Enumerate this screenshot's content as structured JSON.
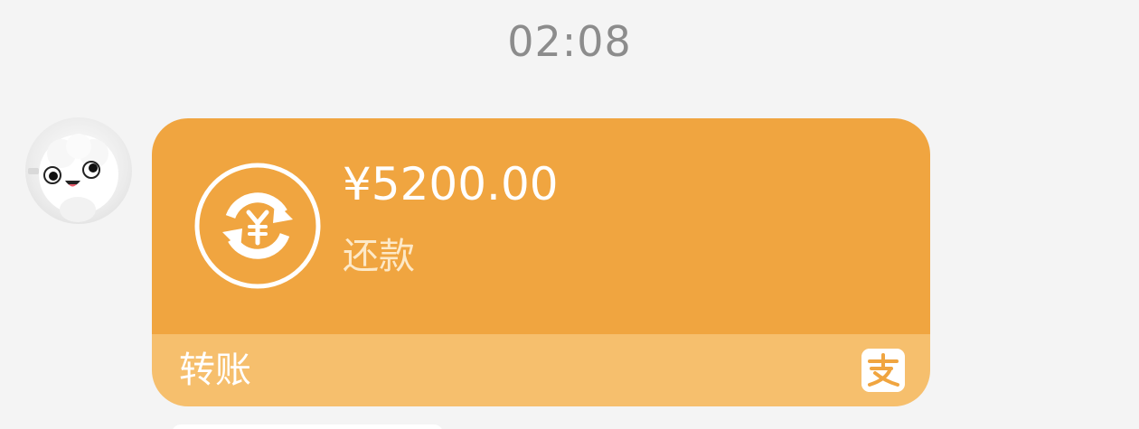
{
  "chat": {
    "timestamp": "02:08",
    "message": {
      "sender_avatar_icon": "cartoon-sheep-avatar-icon",
      "transfer": {
        "amount": "¥5200.00",
        "memo": "还款",
        "footer_label": "转账",
        "status_icon": "refund-yuan-icon",
        "brand_icon": "alipay-icon"
      }
    }
  },
  "colors": {
    "background": "#f4f4f4",
    "bubble_top": "#f0a540",
    "bubble_bottom": "#f6bf6d",
    "timestamp_text": "#8c8c8c",
    "amount_text": "#ffffff",
    "memo_text": "#fde9c8"
  }
}
